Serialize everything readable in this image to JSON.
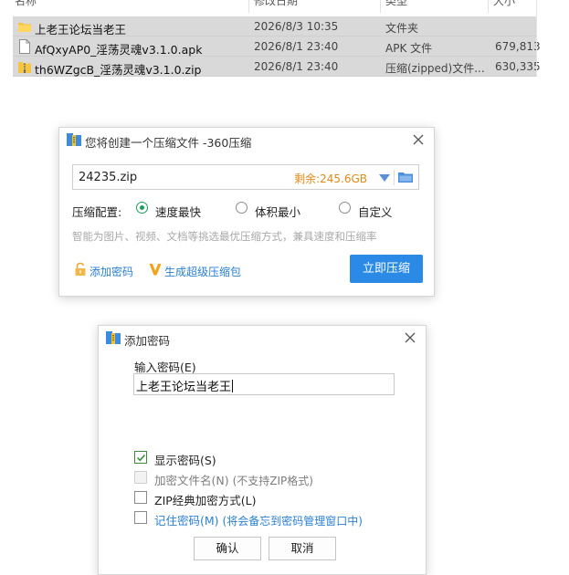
{
  "explorer": {
    "columns": {
      "name": "名称",
      "modified": "修改日期",
      "type": "类型",
      "size": "大小"
    },
    "files": [
      {
        "icon": "folder-icon",
        "name": "上老王论坛当老王",
        "date": "2026/8/3 10:35",
        "type": "文件夹",
        "size": ""
      },
      {
        "icon": "file-icon",
        "name": "AfQxyAP0_淫荡灵魂v3.1.0.apk",
        "date": "2026/8/1 23:40",
        "type": "APK 文件",
        "size": "679,813"
      },
      {
        "icon": "zip-folder-icon",
        "name": "th6WZgcB_淫荡灵魂v3.1.0.zip",
        "date": "2026/8/1 23:40",
        "type": "压缩(zipped)文件...",
        "size": "630,335"
      }
    ]
  },
  "compress_dialog": {
    "title": "您将创建一个压缩文件 -360压缩",
    "filename": "24235.zip",
    "free_space": "剩余:245.6GB",
    "config_label": "压缩配置:",
    "options": [
      {
        "label": "速度最快",
        "selected": true
      },
      {
        "label": "体积最小",
        "selected": false
      },
      {
        "label": "自定义",
        "selected": false
      }
    ],
    "hint": "智能为图片、视频、文档等挑选最优压缩方式，兼具速度和压缩率",
    "add_password": "添加密码",
    "super_package": "生成超级压缩包",
    "compress_now": "立即压缩",
    "accent": "#2a8ae6",
    "selected_color": "#17a05d"
  },
  "password_dialog": {
    "title": "添加密码",
    "input_label": "输入密码(E)",
    "password_value": "上老王论坛当老王",
    "checkboxes": [
      {
        "label": "显示密码(S)",
        "checked": true,
        "enabled": true,
        "note": ""
      },
      {
        "label": "加密文件名(N)",
        "checked": false,
        "enabled": false,
        "note": "(不支持ZIP格式)"
      },
      {
        "label": "ZIP经典加密方式(L)",
        "checked": false,
        "enabled": true,
        "note": ""
      },
      {
        "label": "记住密码(M)",
        "checked": false,
        "enabled": true,
        "note": "(将会备忘到密码管理窗口中)"
      }
    ],
    "ok": "确认",
    "cancel": "取消"
  }
}
